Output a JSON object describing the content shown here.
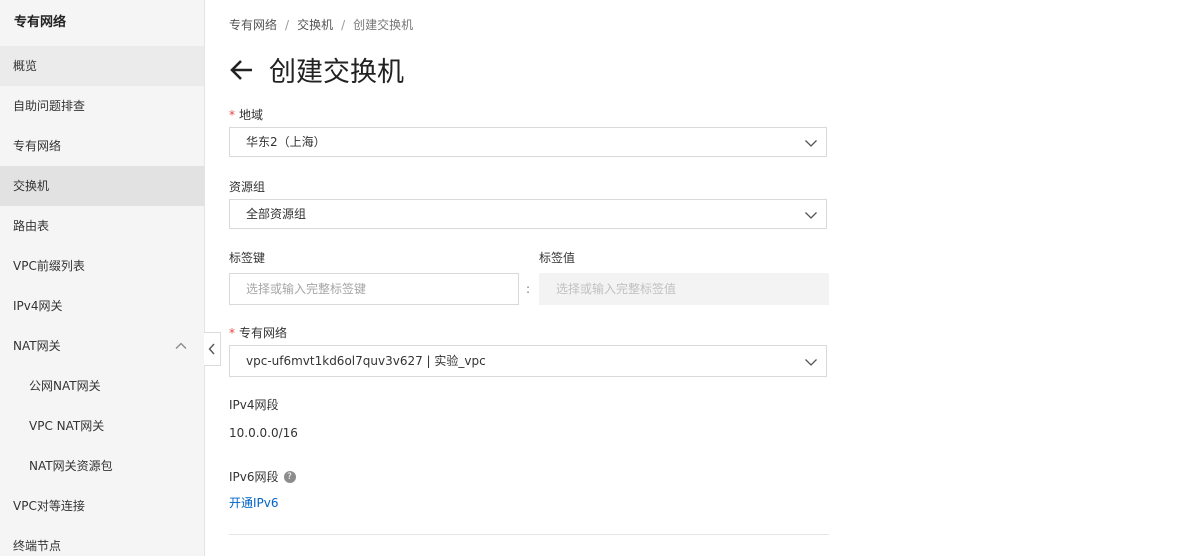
{
  "sidebar": {
    "title": "专有网络",
    "items": [
      {
        "label": "概览"
      },
      {
        "label": "自助问题排查"
      },
      {
        "label": "专有网络"
      },
      {
        "label": "交换机"
      },
      {
        "label": "路由表"
      },
      {
        "label": "VPC前缀列表"
      },
      {
        "label": "IPv4网关"
      },
      {
        "label": "NAT网关"
      },
      {
        "label": "公网NAT网关"
      },
      {
        "label": "VPC NAT网关"
      },
      {
        "label": "NAT网关资源包"
      },
      {
        "label": "VPC对等连接"
      },
      {
        "label": "终端节点"
      }
    ],
    "active_item": "交换机"
  },
  "breadcrumb": {
    "items": [
      "专有网络",
      "交换机",
      "创建交换机"
    ],
    "separator": "/"
  },
  "page": {
    "title": "创建交换机"
  },
  "form": {
    "region": {
      "label": "地域",
      "value": "华东2（上海）"
    },
    "resource_group": {
      "label": "资源组",
      "value": "全部资源组"
    },
    "tag_key": {
      "label": "标签键",
      "placeholder": "选择或输入完整标签键"
    },
    "tag_colon": ":",
    "tag_value": {
      "label": "标签值",
      "placeholder": "选择或输入完整标签值"
    },
    "vpc": {
      "label": "专有网络",
      "value": "vpc-uf6mvt1kd6ol7quv3v627 | 实验_vpc"
    },
    "ipv4_cidr": {
      "label": "IPv4网段",
      "value": "10.0.0.0/16"
    },
    "ipv6_cidr": {
      "label": "IPv6网段",
      "help_glyph": "?",
      "link": "开通IPv6"
    },
    "required_mark": "*"
  },
  "colors": {
    "link": "#0064c8",
    "required": "#e54545",
    "active_bg": "#e2e2e2"
  }
}
